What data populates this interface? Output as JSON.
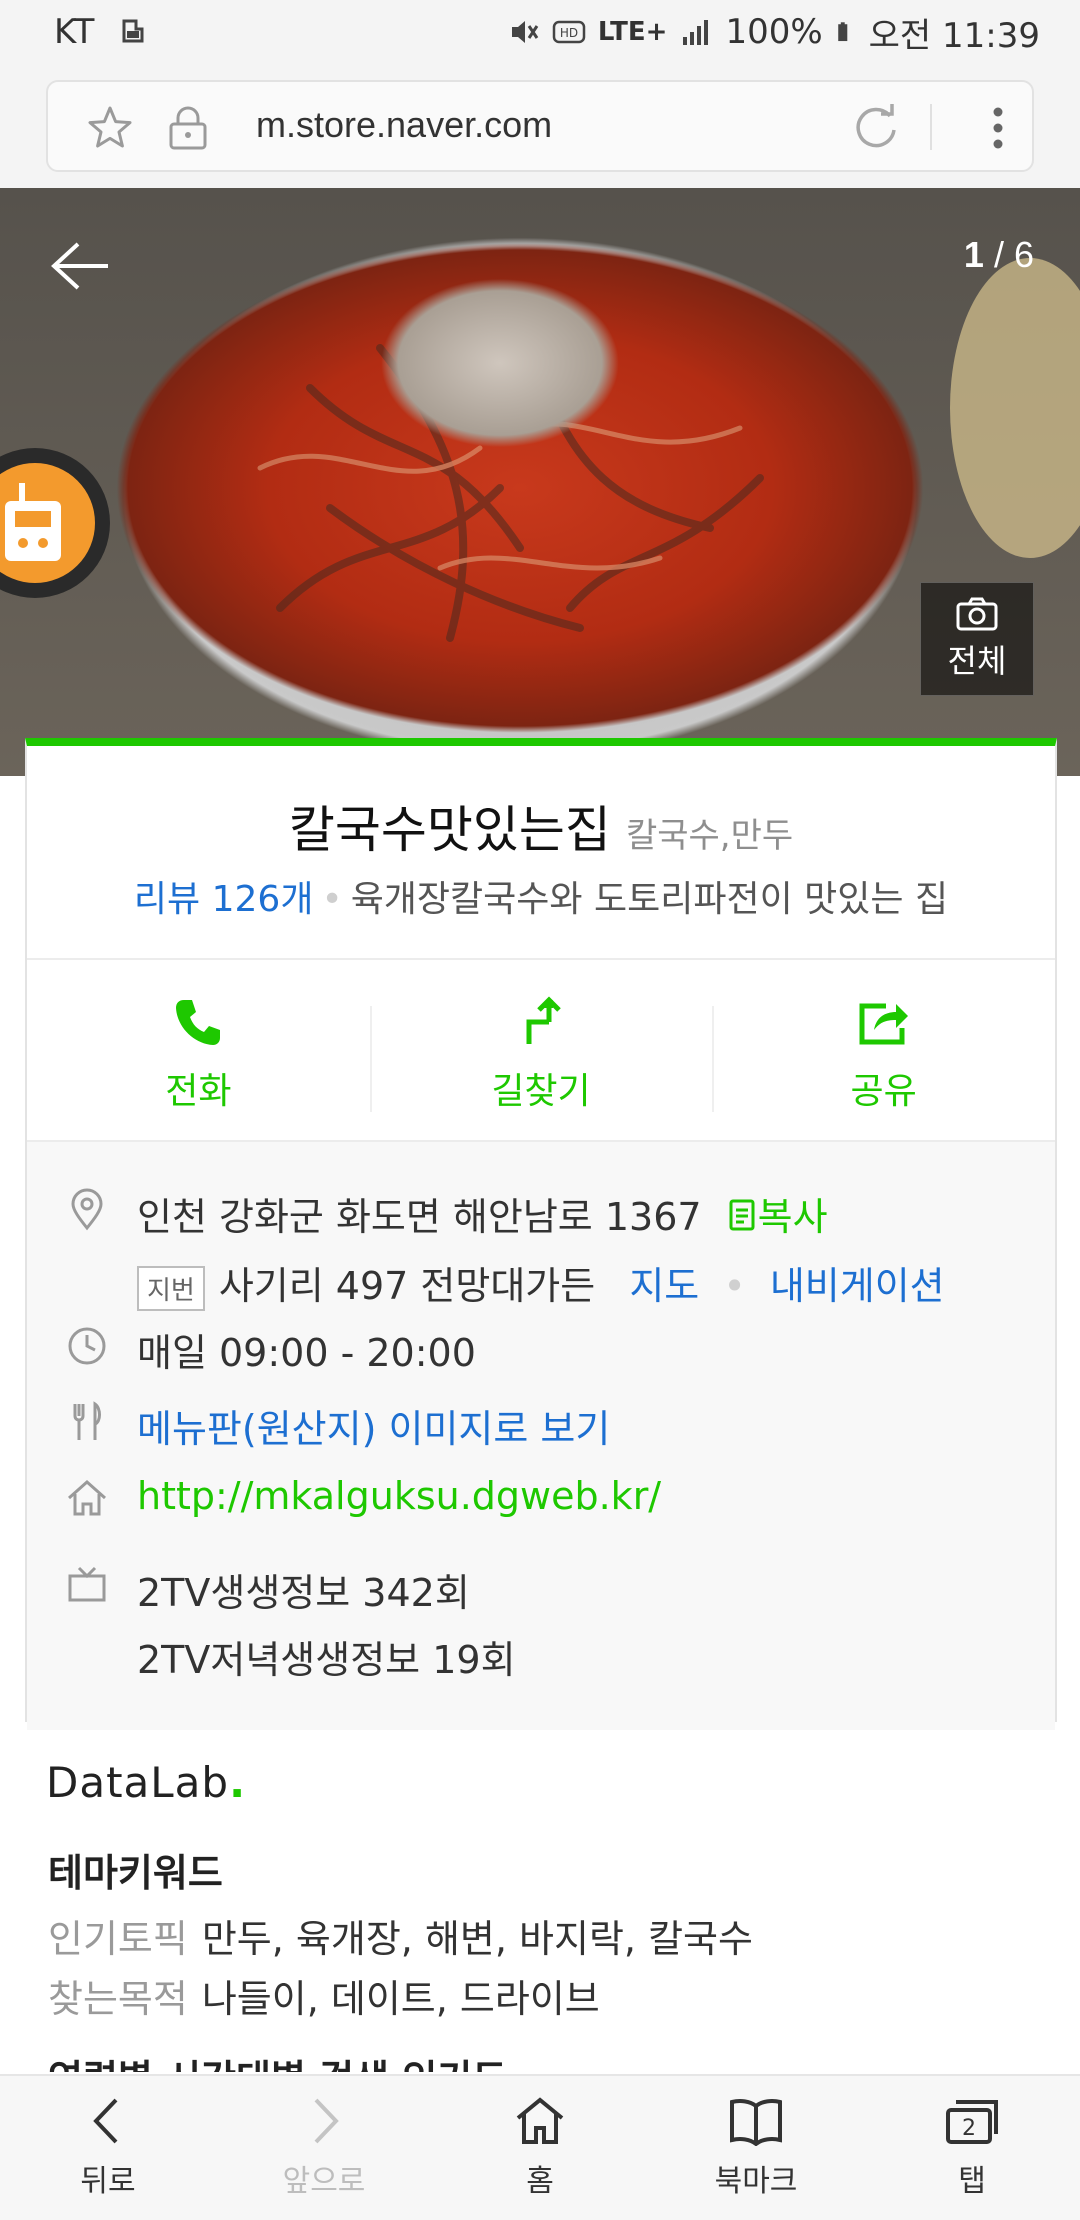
{
  "status_bar": {
    "carrier": "KT",
    "network": "LTE+",
    "battery": "100%",
    "time": "오전 11:39"
  },
  "browser": {
    "url": "m.store.naver.com"
  },
  "gallery": {
    "current": "1",
    "separator": " / ",
    "total": "6",
    "all_button_label": "전체"
  },
  "store": {
    "name": "칼국수맛있는집",
    "category": "칼국수,만두",
    "review_label": "리뷰 126개",
    "description": "육개장칼국수와 도토리파전이 맛있는 집"
  },
  "actions": [
    {
      "label": "전화",
      "icon": "phone-icon"
    },
    {
      "label": "길찾기",
      "icon": "directions-icon"
    },
    {
      "label": "공유",
      "icon": "share-icon"
    }
  ],
  "details": {
    "address": "인천 강화군 화도면 해안남로 1367",
    "copy_label": "복사",
    "lot_tag": "지번",
    "lot_address": "사기리 497 전망대가든",
    "map_label": "지도",
    "navigation_label": "내비게이션",
    "hours": "매일 09:00 - 20:00",
    "menu_link": "메뉴판(원산지) 이미지로 보기",
    "website": "http://mkalguksu.dgweb.kr/",
    "tv_1": "2TV생생정보 342회",
    "tv_2": "2TV저녁생생정보 19회"
  },
  "datalab": {
    "brand_prefix": "DataLab",
    "brand_dot": ".",
    "theme_title": "테마키워드",
    "popular_label": "인기토픽",
    "popular_value": "만두, 육개장, 해변, 바지락, 칼국수",
    "purpose_label": "찾는목적",
    "purpose_value": "나들이, 데이트, 드라이브",
    "cutoff_title": "연령별 시간대별 검색 인기도"
  },
  "bottom_nav": [
    {
      "label": "뒤로",
      "icon": "back-icon",
      "enabled": true
    },
    {
      "label": "앞으로",
      "icon": "forward-icon",
      "enabled": false
    },
    {
      "label": "홈",
      "icon": "home-icon",
      "enabled": true
    },
    {
      "label": "북마크",
      "icon": "bookmark-icon",
      "enabled": true
    },
    {
      "label": "탭",
      "icon": "tabs-icon",
      "enabled": true,
      "badge": "2"
    }
  ],
  "colors": {
    "naver_green": "#1ec800",
    "link_blue": "#1d6fd1"
  }
}
